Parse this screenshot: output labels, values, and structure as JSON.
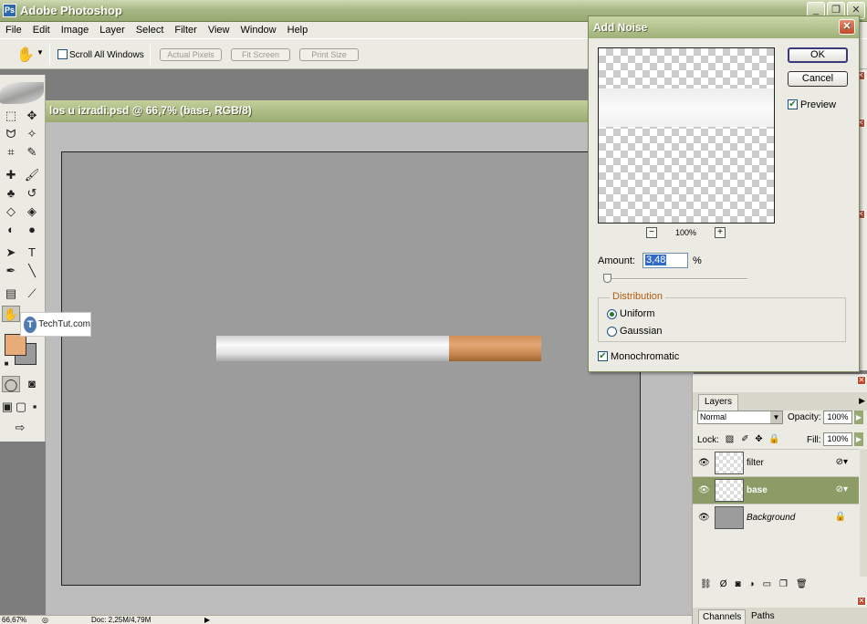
{
  "app": {
    "title": "Adobe Photoshop"
  },
  "window_controls": {
    "minimize": "_",
    "restore": "❐",
    "close": "✕"
  },
  "menu": [
    "File",
    "Edit",
    "Image",
    "Layer",
    "Select",
    "Filter",
    "View",
    "Window",
    "Help"
  ],
  "options_bar": {
    "scroll_all_windows": "Scroll All Windows",
    "scroll_all_checked": false,
    "actual_pixels": "Actual Pixels",
    "fit_screen": "Fit Screen",
    "print_size": "Print Size"
  },
  "document": {
    "title": "los u izradi.psd @ 66,7% (base, RGB/8)"
  },
  "watermark": {
    "text": "TechTut.com"
  },
  "status_bar": {
    "zoom": "66,67%",
    "doc": "Doc: 2,25M/4,79M"
  },
  "dialog": {
    "title": "Add Noise",
    "ok": "OK",
    "cancel": "Cancel",
    "preview_label": "Preview",
    "preview_checked": true,
    "zoom_level": "100%",
    "zoom_out": "−",
    "zoom_in": "+",
    "amount_label": "Amount:",
    "amount_value": "3,48",
    "amount_unit": "%",
    "distribution_label": "Distribution",
    "uniform": "Uniform",
    "gaussian": "Gaussian",
    "distribution_selected": "Uniform",
    "monochromatic": "Monochromatic",
    "monochromatic_checked": true
  },
  "layers_panel": {
    "tab": "Layers",
    "blend_mode": "Normal",
    "opacity_label": "Opacity:",
    "opacity_value": "100%",
    "lock_label": "Lock:",
    "fill_label": "Fill:",
    "fill_value": "100%",
    "layers": [
      {
        "name": "filter"
      },
      {
        "name": "base"
      },
      {
        "name": "Background"
      }
    ]
  },
  "bottom_panel": {
    "channels": "Channels",
    "paths": "Paths"
  },
  "colors": {
    "foreground": "#e7ac78",
    "background": "#9a9a9a",
    "title_green": "#9fb078",
    "selected_layer": "#8d9c66"
  }
}
